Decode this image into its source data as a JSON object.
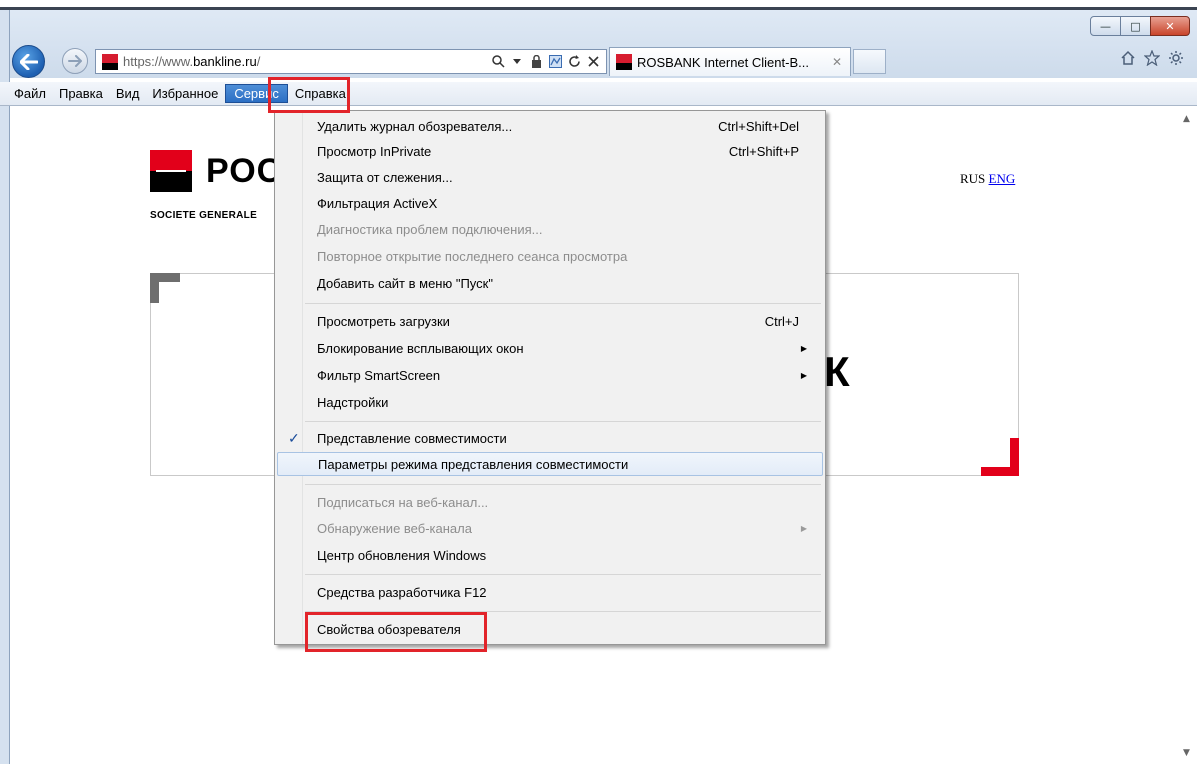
{
  "window": {
    "minimize_glyph": "—",
    "maximize_glyph": "□",
    "close_glyph": "✕"
  },
  "nav": {
    "url_prefix": "https://www.",
    "url_domain": "bankline.ru",
    "url_suffix": "/",
    "tab_title": "ROSBANK Internet Client-B...",
    "tab_close": "✕"
  },
  "menubar": {
    "items": [
      "Файл",
      "Правка",
      "Вид",
      "Избранное",
      "Сервис",
      "Справка"
    ],
    "active": "Сервис"
  },
  "page": {
    "logo_text": "РОС",
    "logo_sub": "SOCIETE GENERALE",
    "lang_current": "RUS",
    "lang_other": "ENG",
    "big_letter": "К"
  },
  "dropdown": {
    "items": [
      {
        "label": "Удалить журнал обозревателя...",
        "shortcut": "Ctrl+Shift+Del"
      },
      {
        "label": "Просмотр InPrivate",
        "shortcut": "Ctrl+Shift+P"
      },
      {
        "label": "Защита от слежения..."
      },
      {
        "label": "Фильтрация ActiveX"
      },
      {
        "label": "Диагностика проблем подключения..."
      },
      {
        "label": "Повторное открытие последнего сеанса просмотра"
      },
      {
        "label": "Добавить сайт в меню \"Пуск\""
      },
      {
        "label": "Просмотреть загрузки",
        "shortcut": "Ctrl+J"
      },
      {
        "label": "Блокирование всплывающих окон"
      },
      {
        "label": "Фильтр SmartScreen"
      },
      {
        "label": "Надстройки"
      },
      {
        "label": "Представление совместимости"
      },
      {
        "label": "Параметры режима представления совместимости"
      },
      {
        "label": "Подписаться на веб-канал..."
      },
      {
        "label": "Обнаружение веб-канала"
      },
      {
        "label": "Центр обновления Windows"
      },
      {
        "label": "Средства разработчика F12"
      },
      {
        "label": "Свойства обозревателя"
      }
    ],
    "checkmark": "✓",
    "submenu_arrow": "▶"
  },
  "colors": {
    "brand_red": "#e2001a",
    "annotation_red": "#e2242a",
    "menu_active": "#2c6fc4"
  }
}
